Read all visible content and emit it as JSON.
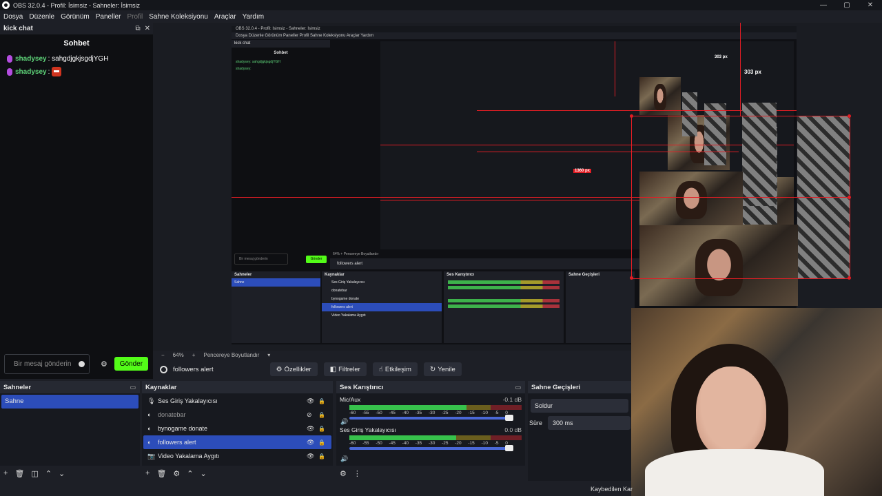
{
  "window": {
    "title": "OBS 32.0.4 - Profil: İsimsiz - Sahneler: İsimsiz",
    "buttons": [
      "—",
      "▢",
      "✕"
    ]
  },
  "menu": [
    {
      "label": "Dosya",
      "disabled": false
    },
    {
      "label": "Düzenle",
      "disabled": false
    },
    {
      "label": "Görünüm",
      "disabled": false
    },
    {
      "label": "Paneller",
      "disabled": false
    },
    {
      "label": "Profil",
      "disabled": true
    },
    {
      "label": "Sahne Koleksiyonu",
      "disabled": false
    },
    {
      "label": "Araçlar",
      "disabled": false
    },
    {
      "label": "Yardım",
      "disabled": false
    }
  ],
  "chat": {
    "dock_title": "kick chat",
    "title": "Sohbet",
    "messages": [
      {
        "user": "shadysey",
        "text": ": sahgdjgkjsgdjYGH",
        "emote": false
      },
      {
        "user": "shadysey",
        "text": ":",
        "emote": true
      }
    ],
    "input_placeholder": "Bir mesaj gönderin",
    "send_label": "Gönder"
  },
  "preview": {
    "nested_title": "OBS 32.0.4 - Profil: İsimsiz - Sahneler: İsimsiz",
    "nested_menu": "Dosya  Düzenle  Görünüm  Paneller  Profil  Sahne Koleksiyonu  Araçlar  Yardım",
    "nested_chat_dock": "kick chat",
    "nested_chat_title": "Sohbet",
    "nested_messages": [
      "shadysey: sahgdjgkjsgdjYGH",
      "shadysey:"
    ],
    "nested_input": "Bir mesaj gönderin",
    "nested_send": "Gönder",
    "nested_zoom": "64%   +   Pencereye Boyutlandır",
    "nested_source": "followers alert",
    "nested_scenes_title": "Sahneler",
    "nested_scene": "Sahne",
    "nested_sources_title": "Kaynaklar",
    "nested_sources": [
      "Ses Giriş Yakalayıcısı",
      "donatebar",
      "bynogame donate",
      "followers alert",
      "Video Yakalama Aygıtı"
    ],
    "nested_mixer_title": "Ses Karıştırıcı",
    "nested_trans_title": "Sahne Geçişleri",
    "nested_lost": "Kaybedilen Ka",
    "label_303": "303 px",
    "label_1360": "1360 px"
  },
  "zoom": {
    "minus": "−",
    "value": "64%",
    "plus": "+",
    "fit_label": "Pencereye Boyutlandır",
    "dropdown": "▾"
  },
  "source_toolbar": {
    "current_source": "followers alert",
    "properties": "Özellikler",
    "filters": "Filtreler",
    "interact": "Etkileşim",
    "refresh": "Yenile"
  },
  "scenes": {
    "title": "Sahneler",
    "items": [
      {
        "label": "Sahne",
        "selected": true
      }
    ]
  },
  "sources": {
    "title": "Kaynaklar",
    "items": [
      {
        "label": "Ses Giriş Yakalayıcısı",
        "icon": "🎙",
        "visible": true,
        "selected": false
      },
      {
        "label": "donatebar",
        "icon": "◐",
        "visible": false,
        "selected": false
      },
      {
        "label": "bynogame donate",
        "icon": "◐",
        "visible": true,
        "selected": false
      },
      {
        "label": "followers alert",
        "icon": "◐",
        "visible": true,
        "selected": true
      },
      {
        "label": "Video Yakalama Aygıtı",
        "icon": "📷",
        "visible": true,
        "selected": false
      }
    ]
  },
  "mixer": {
    "title": "Ses Karıştırıcı",
    "channels": [
      {
        "name": "Mic/Aux",
        "db": "-0.1 dB",
        "level": 0.68
      },
      {
        "name": "Ses Giriş Yakalayıcısı",
        "db": "0.0 dB",
        "level": 0.62
      }
    ],
    "ticks": [
      "-60",
      "-55",
      "-50",
      "-45",
      "-40",
      "-35",
      "-30",
      "-25",
      "-20",
      "-15",
      "-10",
      "-5",
      "0"
    ]
  },
  "transitions": {
    "title": "Sahne Geçişleri",
    "selected": "Soldur",
    "duration_label": "Süre",
    "duration_value": "300 ms"
  },
  "status": {
    "lost_frames": "Kaybedilen Kar"
  }
}
